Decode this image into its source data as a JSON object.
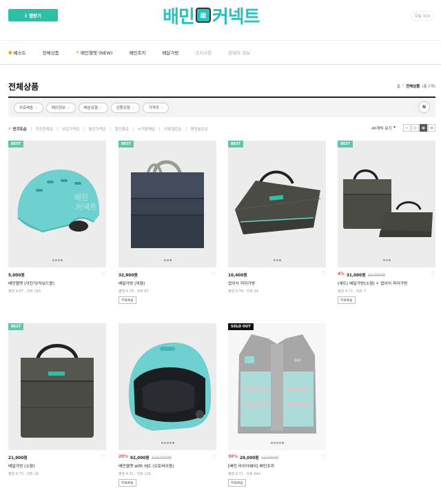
{
  "header": {
    "app_button_label": "앱받기",
    "logo": {
      "part1": "배민",
      "part2": "커넥트"
    },
    "today_label": "오늘 314"
  },
  "nav": {
    "items": [
      {
        "icon": "flame-icon",
        "label": "베스트",
        "dim": false
      },
      {
        "icon": "",
        "label": "전체상품",
        "dim": false
      },
      {
        "icon": "sparkle-icon",
        "label": "배민헬멧 (NEW)",
        "dim": false
      },
      {
        "icon": "",
        "label": "배민조끼",
        "dim": false
      },
      {
        "icon": "",
        "label": "배달가방",
        "dim": false
      },
      {
        "icon": "",
        "label": "공지사항",
        "dim": true
      },
      {
        "icon": "",
        "label": "판매자 정보",
        "dim": true
      }
    ]
  },
  "page": {
    "title": "전체상품",
    "breadcrumb": {
      "home": "홈",
      "current": "전체상품",
      "count": "(총 7개)"
    }
  },
  "filters": {
    "chips": [
      "무료배송",
      "페이정보",
      "배송유형",
      "상품유형",
      "가격대"
    ],
    "reset_label": "N"
  },
  "sort": {
    "options": [
      "인기도순",
      "최신등록순",
      "낮은가격순",
      "높은가격순",
      "할인율순",
      "누적판매순",
      "리뷰많은순",
      "평점높은순"
    ],
    "active_index": 0,
    "per_page": "40개씩 보기"
  },
  "colors": {
    "brand": "#2ac1bc",
    "badge_best": "#5fc4b0",
    "badge_soldout": "#111111",
    "discount": "#e04b4b"
  },
  "products": [
    {
      "badge": "BEST",
      "discount": "",
      "price": "5,000원",
      "original": "",
      "name": "배민헬멧 (자전거/킥보드용)",
      "meta": "평점 4.87 · 리뷰 193",
      "tag": "",
      "image": "helmet-mint",
      "dots": 4
    },
    {
      "badge": "BEST",
      "discount": "",
      "price": "32,900원",
      "original": "",
      "name": "배달가방 (대형)",
      "meta": "평점 4.78 · 리뷰 87",
      "tag": "무료배송",
      "image": "bag-tall-navy",
      "dots": 3
    },
    {
      "badge": "BEST",
      "discount": "",
      "price": "10,400원",
      "original": "",
      "name": "접이식 피자가방",
      "meta": "평점 4.78 · 리뷰 34",
      "tag": "",
      "image": "bag-flat-olive",
      "dots": 3
    },
    {
      "badge": "BEST",
      "discount": "4%",
      "price": "31,000원",
      "original": "32,000원",
      "name": "(세트) 배달가방(소형) + 접이식 피자가방",
      "meta": "평점 4.71 · 리뷰 7",
      "tag": "무료배송",
      "image": "bag-set",
      "dots": 3
    },
    {
      "badge": "BEST",
      "discount": "",
      "price": "21,900원",
      "original": "",
      "name": "배달가방 (소형)",
      "meta": "평점 4.73 · 리뷰 18",
      "tag": "",
      "image": "bag-box-olive",
      "dots": 0
    },
    {
      "badge": "",
      "discount": "20%",
      "price": "92,000원",
      "original": "115,000원",
      "name": "배민헬멧 with HJC (오토바이용)",
      "meta": "평점 4.31 · 리뷰 128",
      "tag": "무료배송",
      "image": "helmet-full",
      "dots": 5
    },
    {
      "badge": "SOLD OUT",
      "discount": "30%",
      "price": "29,000원",
      "original": "42,000원",
      "name": "[배민 라이더웨어] 배민조끼",
      "meta": "평점 4.72 · 리뷰 844",
      "tag": "무료배송",
      "image": "vest",
      "dots": 5
    }
  ]
}
